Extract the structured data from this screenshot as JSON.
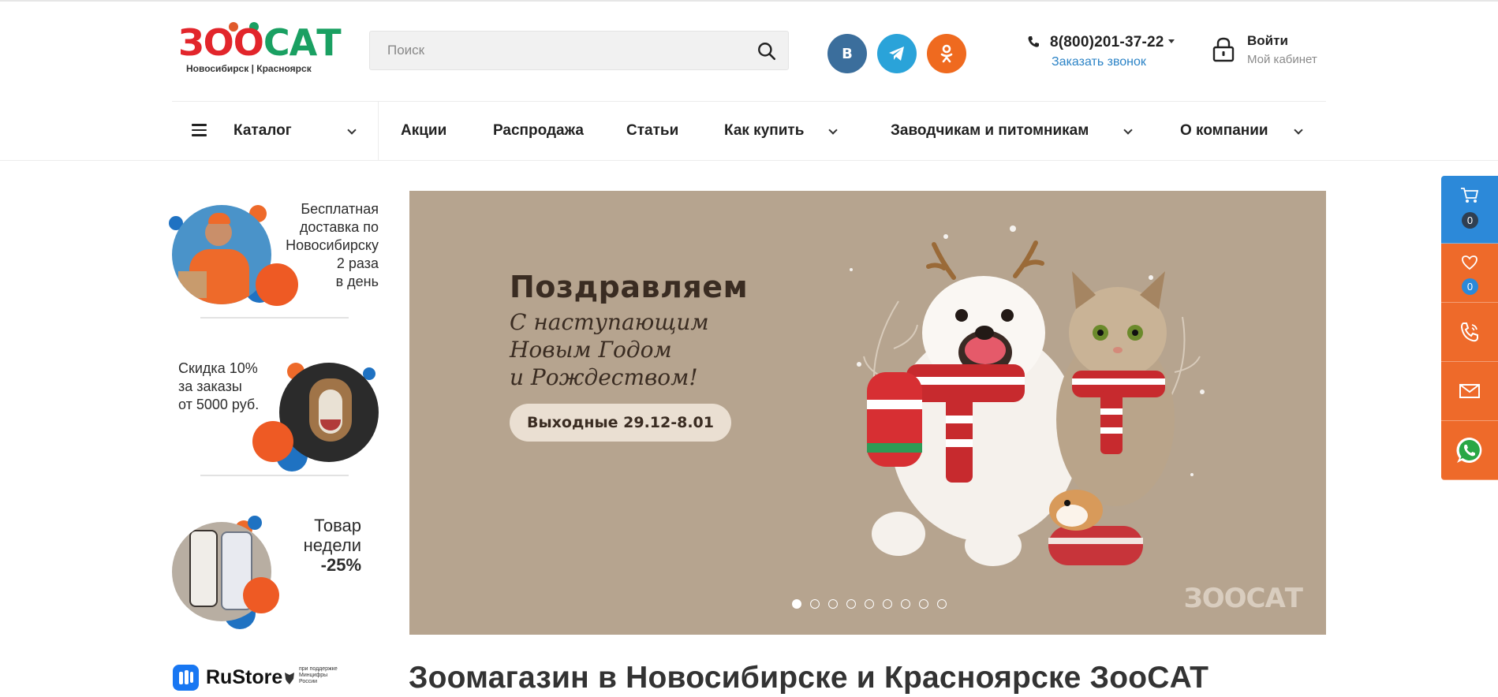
{
  "header": {
    "logo_text": "ЗООСАТ",
    "logo_subtitle": "Новосибирск | Красноярск",
    "search_placeholder": "Поиск",
    "social": [
      {
        "name": "vk",
        "label": "В"
      },
      {
        "name": "telegram"
      },
      {
        "name": "odnoklassniki"
      }
    ],
    "phone": "8(800)201-37-22",
    "callback_label": "Заказать звонок",
    "login_label": "Войти",
    "cabinet_label": "Мой кабинет"
  },
  "nav": {
    "catalog_label": "Каталог",
    "items": [
      {
        "label": "Акции",
        "has_dropdown": false
      },
      {
        "label": "Распродажа",
        "has_dropdown": false
      },
      {
        "label": "Статьи",
        "has_dropdown": false
      },
      {
        "label": "Как купить",
        "has_dropdown": true
      },
      {
        "label": "Заводчикам и питомникам",
        "has_dropdown": true
      },
      {
        "label": "О компании",
        "has_dropdown": true
      }
    ]
  },
  "promos": [
    {
      "lines": [
        "Бесплатная",
        "доставка по",
        "Новосибирску",
        "2 раза",
        "в день"
      ]
    },
    {
      "lines": [
        "Скидка 10%",
        "за заказы",
        "от 5000 руб."
      ]
    },
    {
      "lines": [
        "Товар",
        "недели"
      ],
      "highlight": "-25%"
    }
  ],
  "banner": {
    "title": "Поздравляем",
    "script_lines": [
      "С наступающим",
      "Новым Годом",
      "и Рождеством!"
    ],
    "pill": "Выходные 29.12-8.01",
    "watermark": "ЗООСАТ",
    "slides_total": 9,
    "active_slide": 1
  },
  "page_title": "Зоомагазин в Новосибирске и Красноярске ЗооCAT",
  "rustore": {
    "name": "RuStore",
    "note": "при поддержке Минцифры России"
  },
  "sticky": {
    "cart_count": "0",
    "favorites_count": "0"
  },
  "colors": {
    "accent_orange": "#ee6a2a",
    "accent_blue": "#2c89d9",
    "banner_bg": "#b6a48f",
    "link_blue": "#2b83c6"
  }
}
